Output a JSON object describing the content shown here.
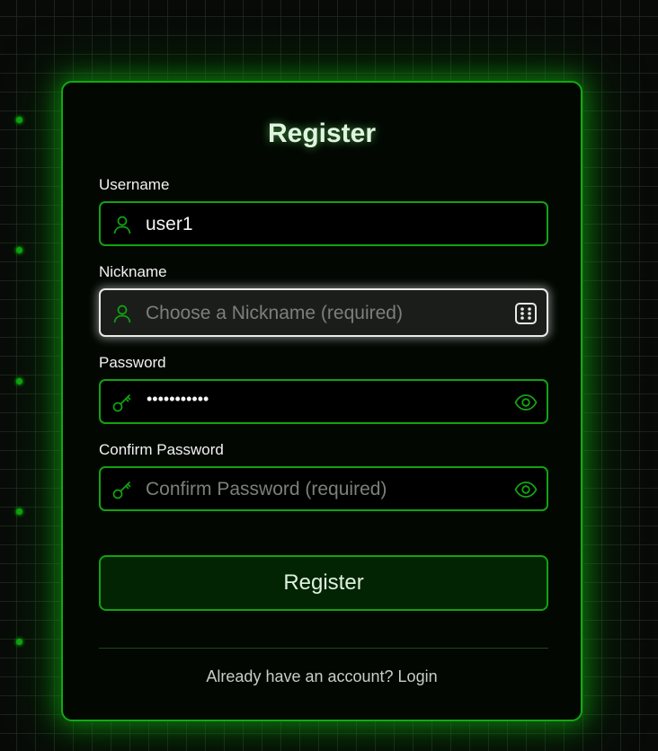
{
  "form": {
    "title": "Register",
    "username": {
      "label": "Username",
      "value": "user1",
      "icon": "user-icon"
    },
    "nickname": {
      "label": "Nickname",
      "placeholder": "Choose a Nickname (required)",
      "icon": "user-icon",
      "action_icon": "dice-icon"
    },
    "password": {
      "label": "Password",
      "masked_value": "•••••••••••",
      "icon": "key-icon",
      "action_icon": "eye-icon"
    },
    "confirm_password": {
      "label": "Confirm Password",
      "placeholder": "Confirm Password (required)",
      "icon": "key-icon",
      "action_icon": "eye-icon"
    },
    "submit_label": "Register",
    "footer_text": "Already have an account? Login"
  },
  "colors": {
    "accent": "#11a311",
    "background": "#080a08",
    "card": "#020702"
  }
}
